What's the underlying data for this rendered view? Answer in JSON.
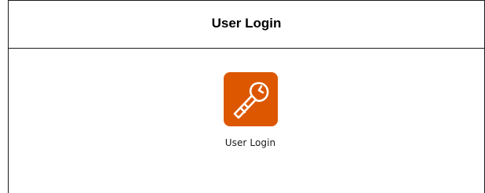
{
  "panel": {
    "title": "User Login"
  },
  "launcher": {
    "label": "User Login",
    "icon": "key-icon",
    "tile_color": "#dc5700",
    "icon_color": "#ffffff"
  }
}
